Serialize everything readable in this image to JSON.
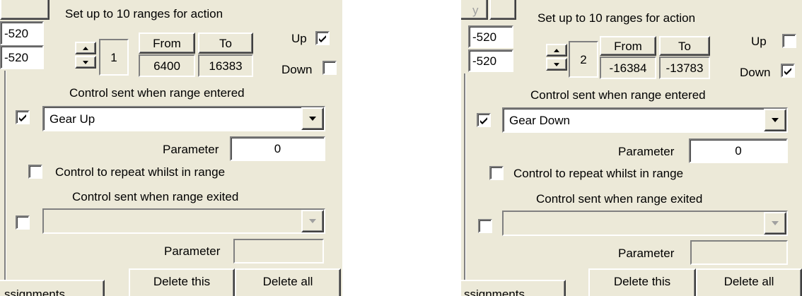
{
  "panels": [
    {
      "fragment_top_edge": "",
      "left_values": [
        "-520",
        "-520"
      ],
      "heading": "Set up to 10 ranges for action",
      "range_number": "1",
      "from_label": "From",
      "to_label": "To",
      "from_value": "6400",
      "to_value": "16383",
      "up_label": "Up",
      "up_checked": true,
      "down_label": "Down",
      "down_checked": false,
      "entered_heading": "Control sent when range entered",
      "entered_enabled": true,
      "entered_control": "Gear Up",
      "parameter_label": "Parameter",
      "entered_parameter": "0",
      "repeat_label": "Control to repeat whilst in range",
      "repeat_checked": false,
      "exited_heading": "Control sent when range exited",
      "exited_enabled": false,
      "exited_control": "",
      "exited_parameter": "",
      "tab_fragment": "ssignments",
      "delete_this_label": "Delete this",
      "delete_all_label": "Delete all"
    },
    {
      "fragment_top_edge": "y",
      "left_values": [
        "-520",
        "-520"
      ],
      "heading": "Set up to 10 ranges for action",
      "range_number": "2",
      "from_label": "From",
      "to_label": "To",
      "from_value": "-16384",
      "to_value": "-13783",
      "up_label": "Up",
      "up_checked": false,
      "down_label": "Down",
      "down_checked": true,
      "entered_heading": "Control sent when range entered",
      "entered_enabled": true,
      "entered_control": "Gear Down",
      "parameter_label": "Parameter",
      "entered_parameter": "0",
      "repeat_label": "Control to repeat whilst in range",
      "repeat_checked": false,
      "exited_heading": "Control sent when range exited",
      "exited_enabled": false,
      "exited_control": "",
      "exited_parameter": "",
      "tab_fragment": "ssignments",
      "delete_this_label": "Delete this",
      "delete_all_label": "Delete all"
    }
  ],
  "icons": {
    "check": "check-mark-icon",
    "spin_up": "spin-up-arrow-icon",
    "spin_down": "spin-down-arrow-icon",
    "dropdown": "dropdown-arrow-icon"
  }
}
